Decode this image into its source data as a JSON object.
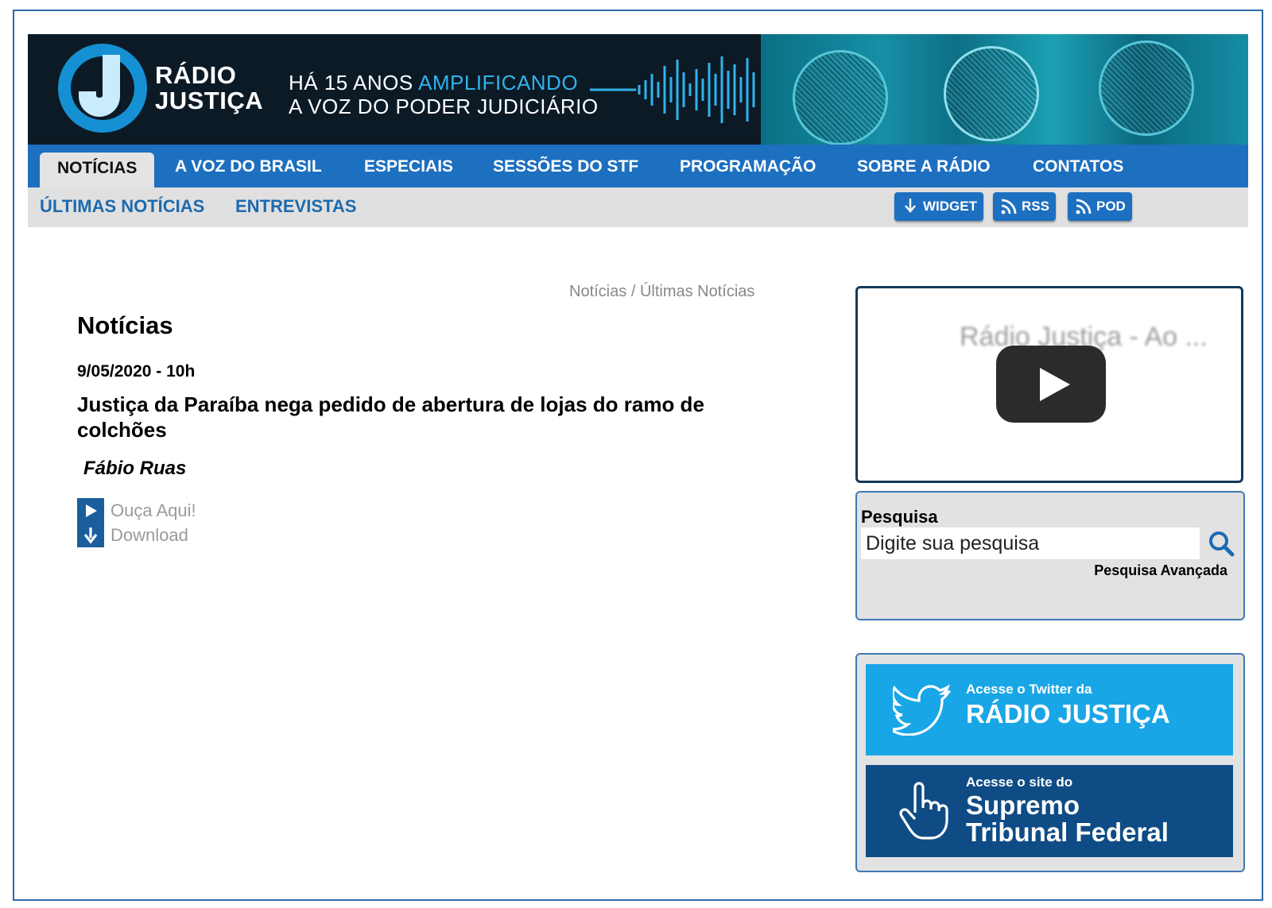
{
  "brand": {
    "line1": "RÁDIO",
    "line2": "JUSTIÇA"
  },
  "tagline": {
    "part1": "HÁ 15 ANOS ",
    "accent": "AMPLIFICANDO",
    "line2": "A VOZ DO PODER JUDICIÁRIO"
  },
  "colors": {
    "nav_blue": "#1d6fc0",
    "accent_cyan": "#31b2ea",
    "dark_banner": "#0c1a26",
    "twitter_blue": "#19a6e6",
    "stf_blue": "#0f4c86"
  },
  "main_nav": [
    {
      "label": "NOTÍCIAS",
      "active": true
    },
    {
      "label": "A VOZ DO BRASIL"
    },
    {
      "label": "ESPECIAIS"
    },
    {
      "label": "SESSÕES DO STF"
    },
    {
      "label": "PROGRAMAÇÃO"
    },
    {
      "label": "SOBRE A RÁDIO"
    },
    {
      "label": "CONTATOS"
    }
  ],
  "sub_nav": [
    {
      "label": "ÚLTIMAS NOTÍCIAS"
    },
    {
      "label": "ENTREVISTAS"
    }
  ],
  "tools": {
    "widget": "WIDGET",
    "rss": "RSS",
    "pod": "POD"
  },
  "breadcrumb": {
    "root": "Notícias",
    "sep": "/",
    "current": "Últimas Notícias"
  },
  "article": {
    "section_title": "Notícias",
    "date": "9/05/2020 - 10h",
    "headline": "Justiça da Paraíba nega pedido de abertura de lojas do ramo de colchões",
    "author": "Fábio Ruas",
    "listen_label": "Ouça Aqui!",
    "download_label": "Download"
  },
  "video": {
    "title": "Rádio Justiça - Ao ..."
  },
  "search": {
    "label": "Pesquisa",
    "placeholder": "Digite sua pesquisa",
    "advanced": "Pesquisa Avançada"
  },
  "promos": {
    "twitter": {
      "small": "Acesse o Twitter da",
      "big": "RÁDIO JUSTIÇA"
    },
    "stf": {
      "small": "Acesse o site do",
      "big1": "Supremo",
      "big2": "Tribunal Federal"
    }
  }
}
